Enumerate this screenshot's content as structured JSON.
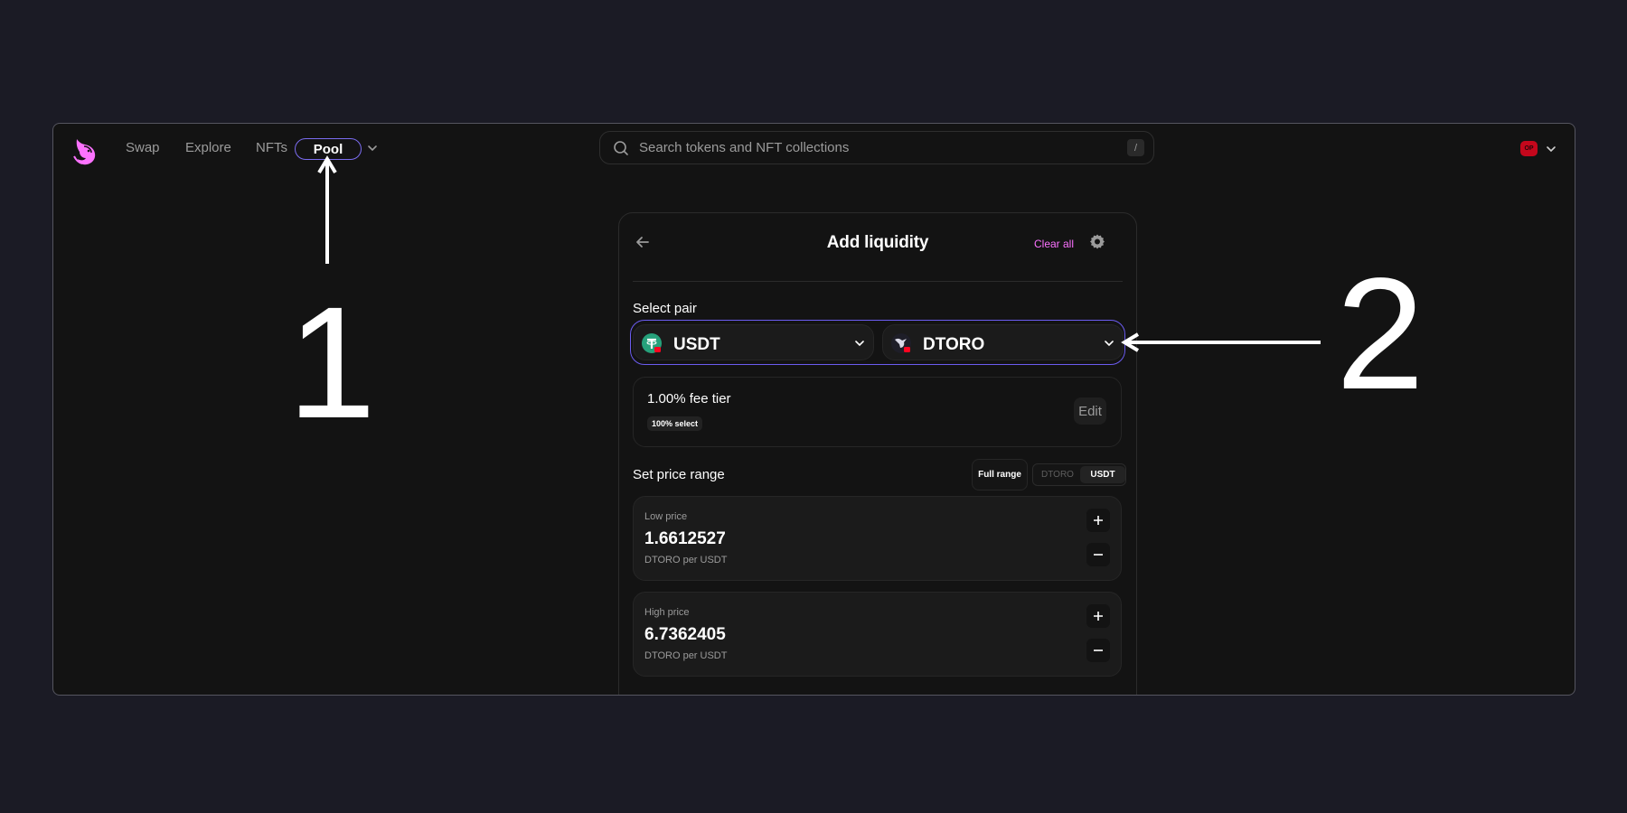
{
  "nav": {
    "links": [
      "Swap",
      "Explore",
      "NFTs"
    ],
    "active": "Pool",
    "network_badge": "OP"
  },
  "search": {
    "placeholder": "Search tokens and NFT collections",
    "shortcut": "/"
  },
  "card": {
    "title": "Add liquidity",
    "clear_all": "Clear all",
    "select_pair_label": "Select pair",
    "token_a": "USDT",
    "token_b": "DTORO",
    "fee_tier": "1.00% fee tier",
    "fee_select": "100% select",
    "edit": "Edit",
    "price_range_label": "Set price range",
    "full_range": "Full range",
    "toggle": [
      "DTORO",
      "USDT"
    ],
    "toggle_selected": "USDT",
    "low_price": {
      "label": "Low price",
      "value": "1.6612527",
      "unit": "DTORO per USDT"
    },
    "high_price": {
      "label": "High price",
      "value": "6.7362405",
      "unit": "DTORO per USDT"
    }
  },
  "annotations": [
    "1",
    "2"
  ],
  "colors": {
    "background": "#1b1b25",
    "app": "#131313",
    "accent_pink": "#fc72ff",
    "highlight_outline": "#6b5cf0"
  }
}
